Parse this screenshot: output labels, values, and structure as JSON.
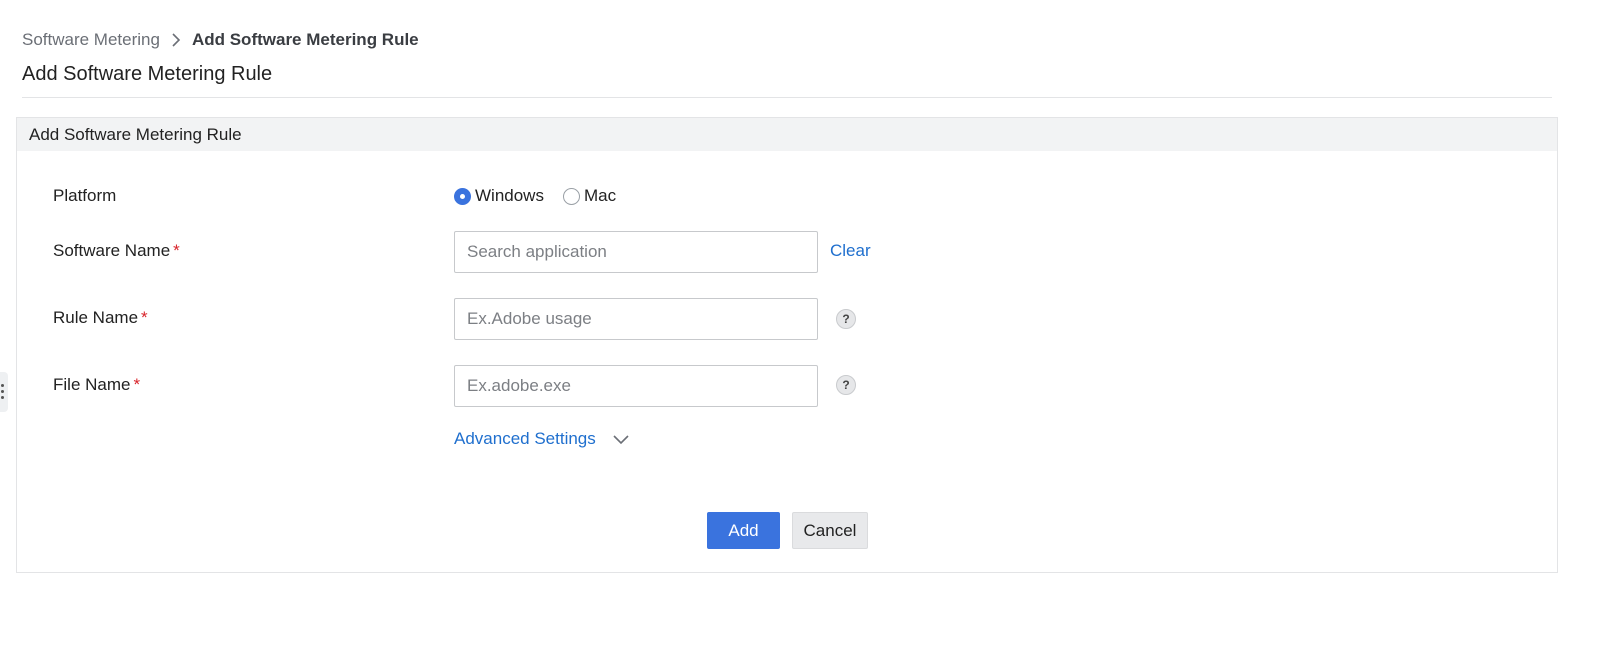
{
  "breadcrumb": {
    "parent": "Software Metering",
    "current": "Add Software Metering Rule"
  },
  "page_title": "Add Software Metering Rule",
  "panel": {
    "header": "Add Software Metering Rule"
  },
  "form": {
    "platform": {
      "label": "Platform",
      "options": [
        {
          "label": "Windows",
          "selected": true
        },
        {
          "label": "Mac",
          "selected": false
        }
      ]
    },
    "software_name": {
      "label": "Software Name",
      "required": "*",
      "value": "",
      "placeholder": "Search application",
      "clear_label": "Clear"
    },
    "rule_name": {
      "label": "Rule Name",
      "required": "*",
      "value": "",
      "placeholder": "Ex.Adobe usage",
      "help": "?"
    },
    "file_name": {
      "label": "File Name",
      "required": "*",
      "value": "",
      "placeholder": "Ex.adobe.exe",
      "help": "?"
    },
    "advanced_settings_label": "Advanced Settings"
  },
  "actions": {
    "add_label": "Add",
    "cancel_label": "Cancel"
  },
  "icons": {
    "breadcrumb_separator": "chevron-right-icon",
    "advanced_toggle": "chevron-down-icon",
    "help": "help-icon",
    "side_handle": "more-vertical-icon"
  },
  "colors": {
    "accent": "#3a73de",
    "link": "#1f6fce",
    "required": "#d8232a",
    "panel_header_bg": "#f2f3f4"
  }
}
